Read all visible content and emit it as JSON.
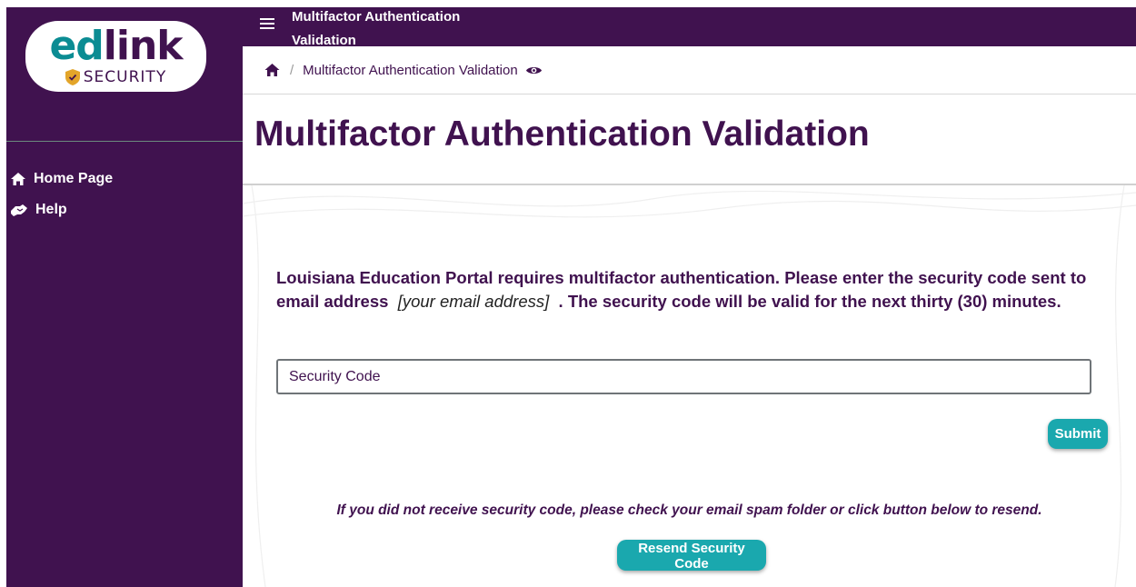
{
  "logo": {
    "brand_part1": "ed",
    "brand_part2": "link",
    "brand_sub": "SECURITY",
    "teal": "#0b8c93"
  },
  "sidebar": {
    "items": [
      {
        "label": "Home Page",
        "icon": "home-icon"
      },
      {
        "label": "Help",
        "icon": "handshake-icon"
      }
    ]
  },
  "topbar": {
    "title": "Multifactor Authentication Validation",
    "icon": "hamburger-menu-icon"
  },
  "breadcrumb": {
    "current": "Multifactor Authentication Validation",
    "icons": [
      "home-icon",
      "eye-icon"
    ]
  },
  "page": {
    "title": "Multifactor Authentication Validation"
  },
  "form": {
    "message_part1": "Louisiana Education Portal requires multifactor authentication. Please enter the security code sent to email address",
    "email_placeholder": "[your email address]",
    "message_part2": ". The security code will be valid for the next thirty (30) minutes.",
    "input_placeholder": "Security Code",
    "submit_label": "Submit",
    "resend_note": "If you did not receive security code, please check your email spam folder or click button below to resend.",
    "resend_label": "Resend Security Code"
  },
  "colors": {
    "primary_purple": "#40124f",
    "button_teal": "#1aa8ae"
  }
}
